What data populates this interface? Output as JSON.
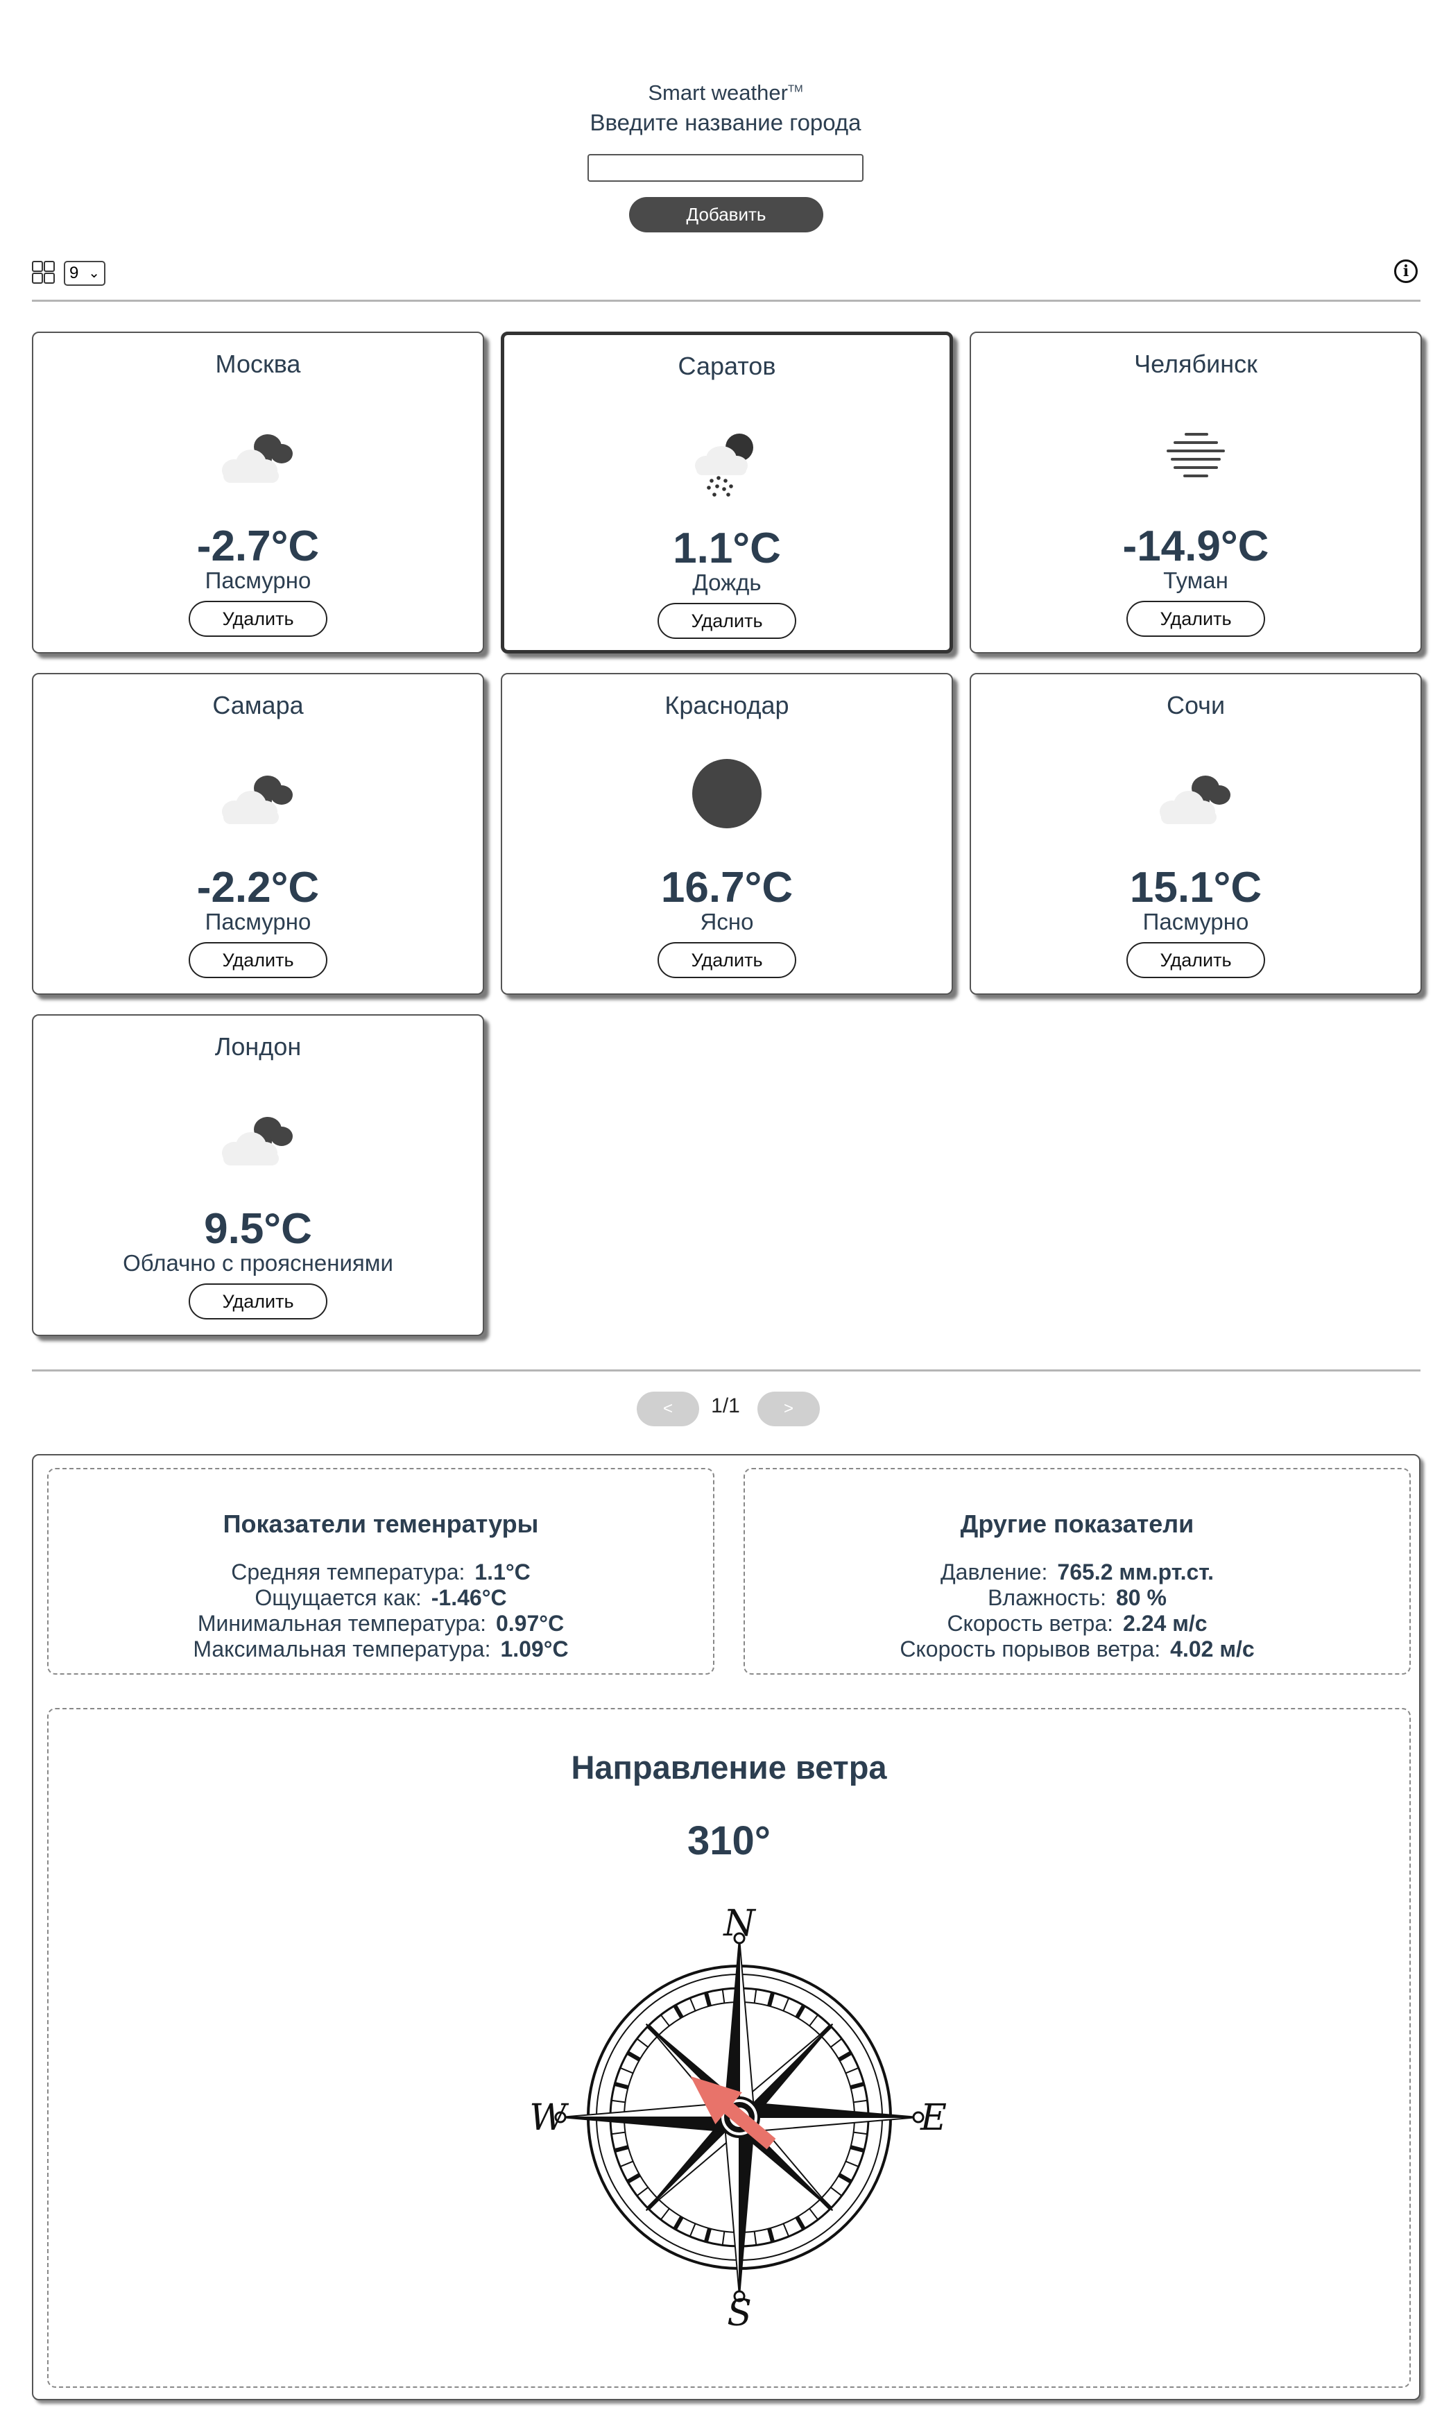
{
  "header": {
    "brand": "Smart weather",
    "brand_mark": "TM",
    "prompt": "Введите название города",
    "input_value": "",
    "add_button": "Добавить"
  },
  "toolbar": {
    "page_size": "9",
    "grid_icon": "grid-icon",
    "info_icon": "info-icon"
  },
  "cards": [
    {
      "city": "Москва",
      "temp": "-2.7°C",
      "desc": "Пасмурно",
      "icon": "cloudy-icon",
      "delete": "Удалить"
    },
    {
      "city": "Саратов",
      "temp": "1.1°C",
      "desc": "Дождь",
      "icon": "rain-icon",
      "delete": "Удалить"
    },
    {
      "city": "Челябинск",
      "temp": "-14.9°C",
      "desc": "Туман",
      "icon": "fog-icon",
      "delete": "Удалить"
    },
    {
      "city": "Самара",
      "temp": "-2.2°C",
      "desc": "Пасмурно",
      "icon": "cloudy-icon",
      "delete": "Удалить"
    },
    {
      "city": "Краснодар",
      "temp": "16.7°C",
      "desc": "Ясно",
      "icon": "clear-icon",
      "delete": "Удалить"
    },
    {
      "city": "Сочи",
      "temp": "15.1°C",
      "desc": "Пасмурно",
      "icon": "cloudy-icon",
      "delete": "Удалить"
    },
    {
      "city": "Лондон",
      "temp": "9.5°C",
      "desc": "Облачно с прояснениями",
      "icon": "cloudy-icon",
      "delete": "Удалить"
    }
  ],
  "pagination": {
    "prev": "<",
    "label": "1/1",
    "next": ">"
  },
  "details": {
    "temperature": {
      "title": "Показатели теменратуры",
      "rows": [
        {
          "label": "Средняя температура:",
          "value": "1.1°C"
        },
        {
          "label": "Ощущается как:",
          "value": "-1.46°C"
        },
        {
          "label": "Минимальная температура:",
          "value": "0.97°C"
        },
        {
          "label": "Максимальная температура:",
          "value": "1.09°C"
        }
      ]
    },
    "other": {
      "title": "Другие показатели",
      "rows": [
        {
          "label": "Давление:",
          "value": "765.2 мм.рт.ст."
        },
        {
          "label": "Влажность:",
          "value": "80 %"
        },
        {
          "label": "Скорость ветра:",
          "value": "2.24 м/с"
        },
        {
          "label": "Скорость порывов ветра:",
          "value": "4.02 м/с"
        }
      ]
    },
    "wind": {
      "title": "Направление ветра",
      "degree_text": "310°",
      "degree": 310,
      "compass_labels": {
        "n": "N",
        "e": "E",
        "s": "S",
        "w": "W"
      },
      "arrow_color": "#e8736a"
    }
  }
}
